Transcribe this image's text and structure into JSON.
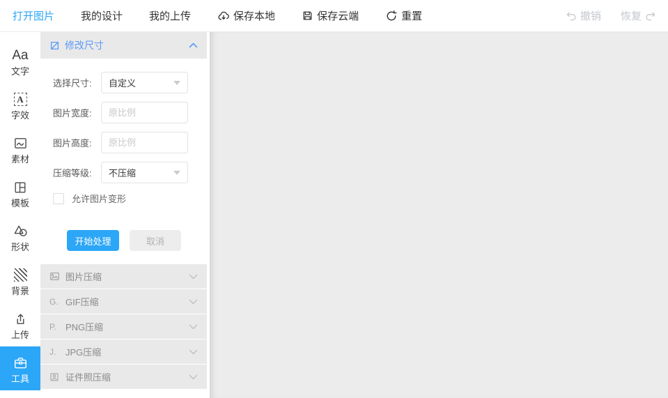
{
  "colors": {
    "accent": "#2ca6f7",
    "header_blue": "#5b9bf8",
    "panel_gray": "#e9e9e9",
    "canvas_gray": "#ececec"
  },
  "toolbar": {
    "open_image": "打开图片",
    "my_designs": "我的设计",
    "my_uploads": "我的上传",
    "save_local": "保存本地",
    "save_cloud": "保存云端",
    "reset": "重置",
    "undo": "撤销",
    "redo": "恢复"
  },
  "sidebar": {
    "items": [
      {
        "label": "文字",
        "icon": "text-icon",
        "glyph": "Aa"
      },
      {
        "label": "字效",
        "icon": "text-effect-icon",
        "glyph": "A"
      },
      {
        "label": "素材",
        "icon": "image-icon"
      },
      {
        "label": "模板",
        "icon": "template-icon"
      },
      {
        "label": "形状",
        "icon": "shapes-icon"
      },
      {
        "label": "背景",
        "icon": "background-icon"
      },
      {
        "label": "上传",
        "icon": "upload-icon"
      },
      {
        "label": "工具",
        "icon": "toolbox-icon",
        "active": true
      }
    ]
  },
  "panel": {
    "resize": {
      "title": "修改尺寸",
      "size_label": "选择尺寸:",
      "size_value": "自定义",
      "width_label": "图片宽度:",
      "width_placeholder": "原比例",
      "height_label": "图片高度:",
      "height_placeholder": "原比例",
      "level_label": "压缩等级:",
      "level_value": "不压缩",
      "checkbox_label": "允许图片变形",
      "checkbox_checked": false,
      "start_button": "开始处理",
      "cancel_button": "取消"
    },
    "sections": [
      {
        "label": "图片压缩"
      },
      {
        "label": "GIF压缩",
        "icon_text": "G."
      },
      {
        "label": "PNG压缩",
        "icon_text": "P."
      },
      {
        "label": "JPG压缩",
        "icon_text": "J."
      },
      {
        "label": "证件照压缩"
      }
    ]
  }
}
